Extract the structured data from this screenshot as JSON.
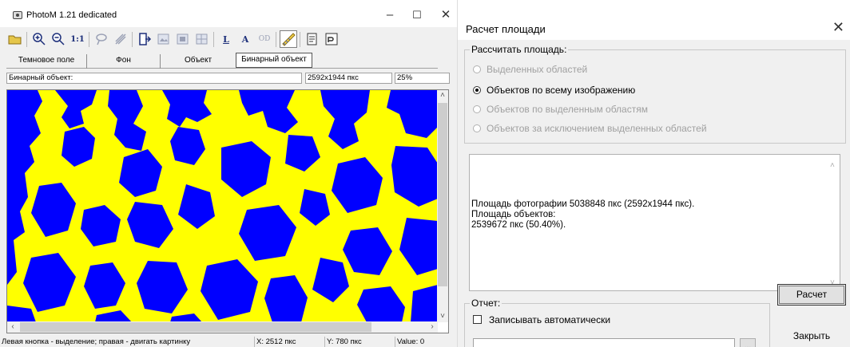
{
  "photom": {
    "title": "PhotoM 1.21 dedicated",
    "window_controls": {
      "minimize": "–",
      "maximize": "☐",
      "close": "✕"
    },
    "toolbar": {
      "zoom_actual": "1:1",
      "text_tool": "A",
      "od_tool": "OD",
      "line_tool": "L"
    },
    "tabs": [
      "Темновое поле",
      "Фон",
      "Объект",
      "Бинарный объект"
    ],
    "active_tab": "Бинарный объект",
    "info": {
      "label": "Бинарный объект:",
      "size": "2592x1944 пкс",
      "zoom": "25%"
    },
    "image": {
      "primary_color": "#ffff00",
      "object_color": "#0000ff"
    },
    "status": {
      "hint": "Левая кнопка - выделение; правая - двигать картинку",
      "x": "X: 2512 пкс",
      "y": "Y: 780 пкс",
      "value": "Value: 0"
    }
  },
  "dialog": {
    "title": "Расчет площади",
    "close": "✕",
    "calc_group": {
      "legend": "Рассчитать площадь:",
      "options": [
        {
          "label": "Выделенных областей",
          "checked": false,
          "enabled": false
        },
        {
          "label": "Объектов по всему изображению",
          "checked": true,
          "enabled": true
        },
        {
          "label": "Объектов по выделенным областям",
          "checked": false,
          "enabled": false
        },
        {
          "label": "Объектов за исключением выделенных областей",
          "checked": false,
          "enabled": false
        }
      ]
    },
    "result": {
      "line1": "Площадь фотографии 5038848 пкс (2592x1944 пкс).",
      "line2": "Площадь объектов:",
      "line3": "2539672 пкс (50.40%)."
    },
    "report_group": {
      "legend": "Отчет:",
      "auto_save_label": "Записывать автоматически",
      "auto_save_checked": false,
      "path_value": "",
      "browse_label": "..."
    },
    "buttons": {
      "calculate": "Расчет",
      "close": "Закрыть"
    }
  }
}
